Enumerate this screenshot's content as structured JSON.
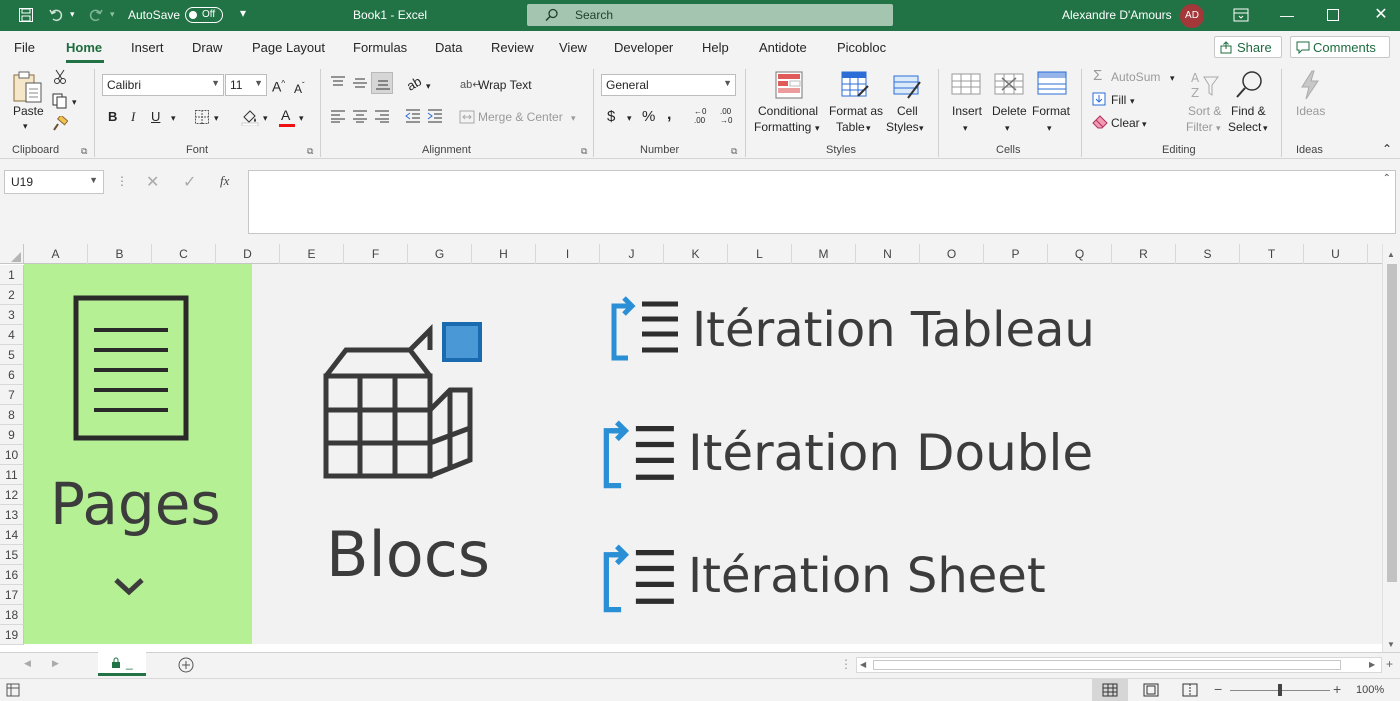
{
  "titlebar": {
    "autosave_label": "AutoSave",
    "autosave_state": "Off",
    "document_title": "Book1  -  Excel",
    "search_placeholder": "Search",
    "user_name": "Alexandre D'Amours",
    "user_initials": "AD"
  },
  "menu": {
    "tabs": [
      "File",
      "Home",
      "Insert",
      "Draw",
      "Page Layout",
      "Formulas",
      "Data",
      "Review",
      "View",
      "Developer",
      "Help",
      "Antidote",
      "Picobloc"
    ],
    "active_tab": "Home",
    "share_label": "Share",
    "comments_label": "Comments"
  },
  "ribbon": {
    "clipboard": {
      "label": "Clipboard",
      "paste": "Paste"
    },
    "font": {
      "label": "Font",
      "font_name": "Calibri",
      "font_size": "11",
      "bold": "B",
      "italic": "I",
      "underline": "U"
    },
    "alignment": {
      "label": "Alignment",
      "wrap_text": "Wrap Text",
      "merge_center": "Merge & Center"
    },
    "number": {
      "label": "Number",
      "format": "General"
    },
    "styles": {
      "label": "Styles",
      "conditional_formatting_1": "Conditional",
      "conditional_formatting_2": "Formatting",
      "format_as_table_1": "Format as",
      "format_as_table_2": "Table",
      "cell_styles_1": "Cell",
      "cell_styles_2": "Styles"
    },
    "cells": {
      "label": "Cells",
      "insert": "Insert",
      "delete": "Delete",
      "format": "Format"
    },
    "editing": {
      "label": "Editing",
      "autosum": "AutoSum",
      "fill": "Fill",
      "clear": "Clear",
      "sort_filter_1": "Sort &",
      "sort_filter_2": "Filter",
      "find_select_1": "Find &",
      "find_select_2": "Select"
    },
    "ideas": {
      "label": "Ideas",
      "ideas": "Ideas"
    }
  },
  "formula_bar": {
    "name_box": "U19",
    "fx": "fx",
    "value": ""
  },
  "grid": {
    "columns": [
      "A",
      "B",
      "C",
      "D",
      "E",
      "F",
      "G",
      "H",
      "I",
      "J",
      "K",
      "L",
      "M",
      "N",
      "O",
      "P",
      "Q",
      "R",
      "S",
      "T",
      "U"
    ],
    "rows": [
      "1",
      "2",
      "3",
      "4",
      "5",
      "6",
      "7",
      "8",
      "9",
      "10",
      "11",
      "12",
      "13",
      "14",
      "15",
      "16",
      "17",
      "18",
      "19"
    ]
  },
  "picture": {
    "pages_label": "Pages",
    "blocs_label": "Blocs",
    "iterations": [
      "Itération Tableau",
      "Itération Double",
      "Itération Sheet"
    ]
  },
  "sheet_tabs": {
    "active_sheet": "_"
  },
  "statusbar": {
    "zoom": "100%"
  },
  "colors": {
    "excel_green": "#217346",
    "pages_bg": "#b6f094",
    "iteration_blue": "#2b8fd6"
  }
}
